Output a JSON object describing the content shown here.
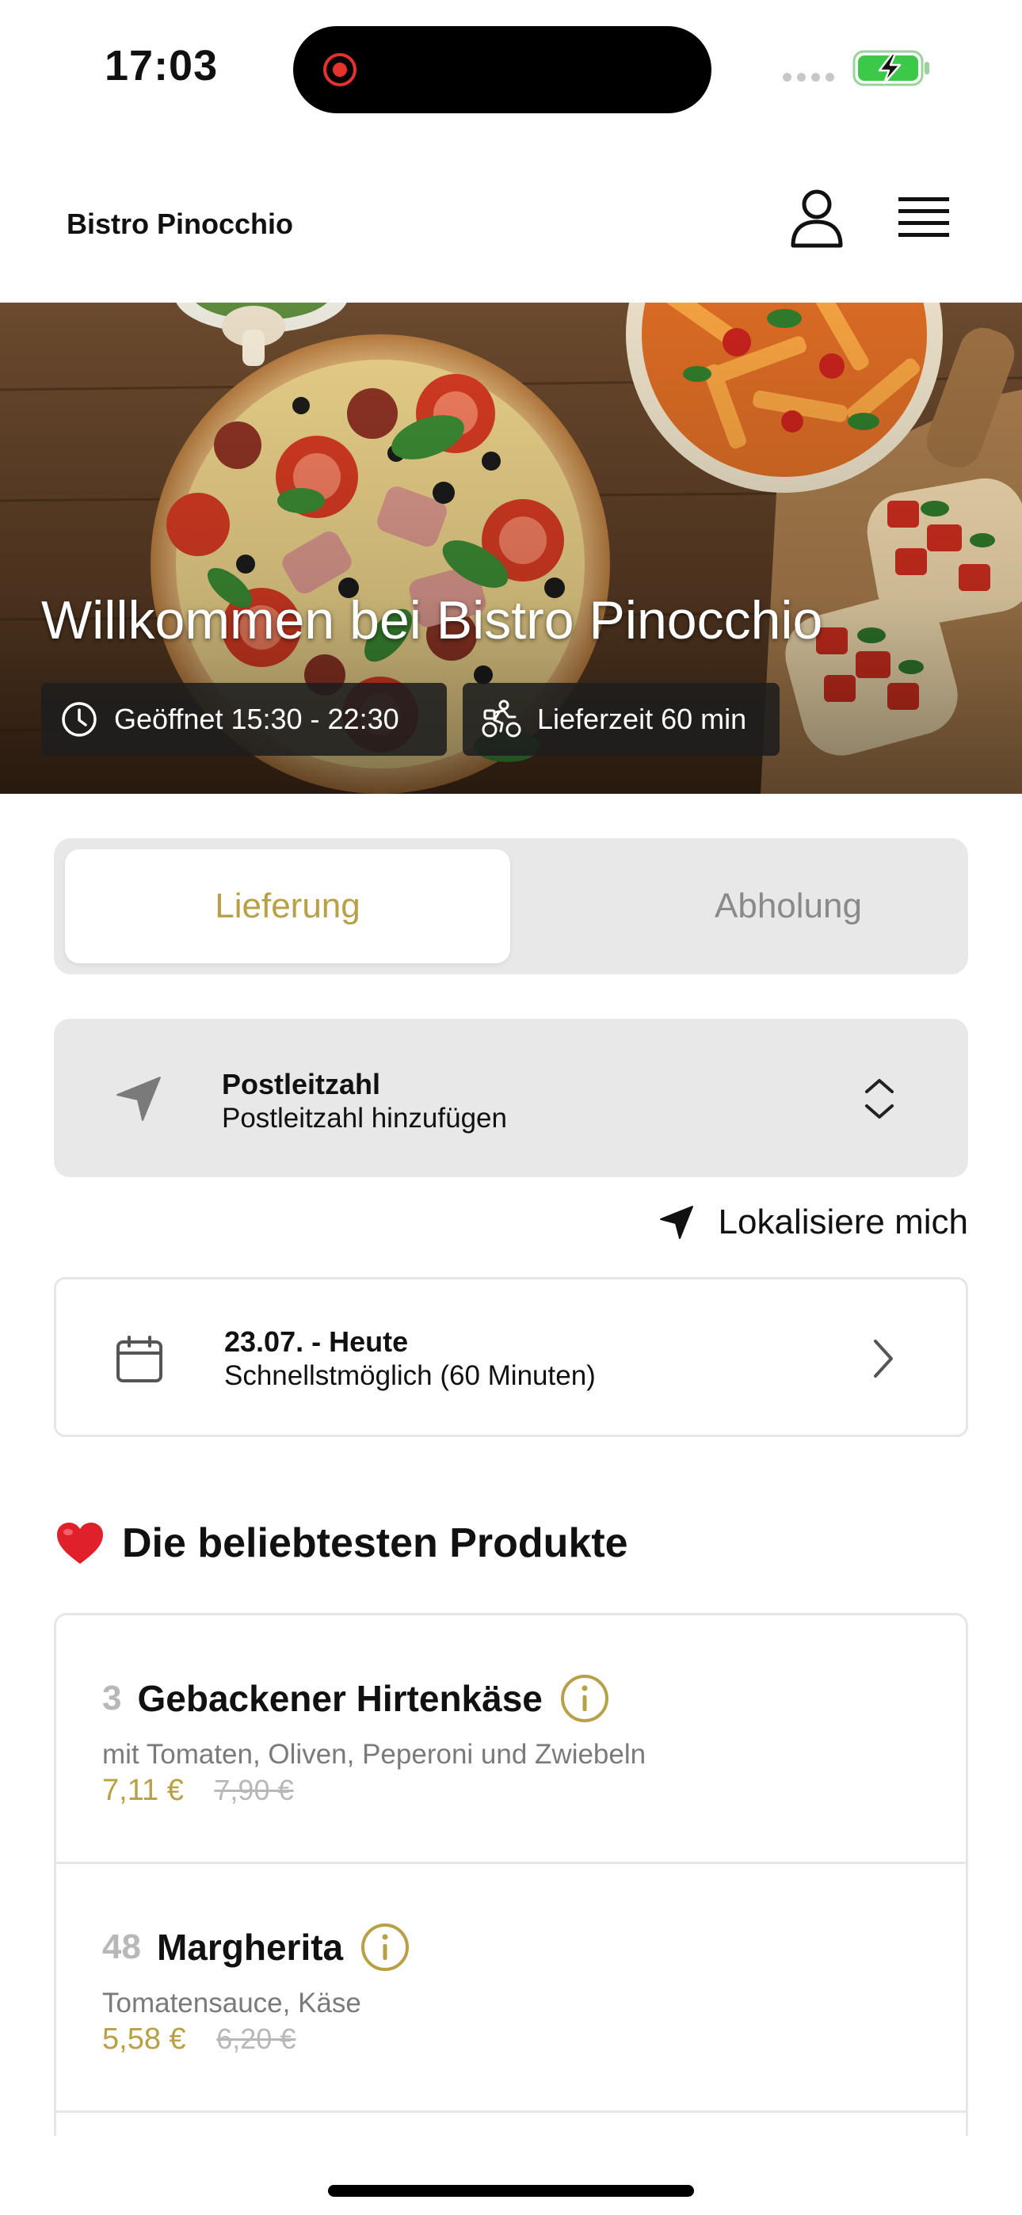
{
  "status_bar": {
    "time": "17:03",
    "battery_icon": "battery-charging-icon",
    "recording_icon": "screen-recording-icon"
  },
  "header": {
    "brand": "Bistro Pinocchio",
    "user_icon": "user-icon",
    "menu_icon": "hamburger-menu-icon"
  },
  "hero": {
    "title": "Willkommen bei Bistro Pinocchio",
    "opening_hours": "Geöffnet 15:30 - 22:30",
    "delivery_time": "Lieferzeit 60 min",
    "opening_icon": "clock-icon",
    "delivery_icon": "bicycle-courier-icon"
  },
  "order_mode": {
    "tabs": [
      {
        "label": "Lieferung",
        "active": true
      },
      {
        "label": "Abholung",
        "active": false
      }
    ]
  },
  "postal_code": {
    "title": "Postleitzahl",
    "placeholder": "Postleitzahl hinzufügen",
    "icon": "location-arrow-icon"
  },
  "locate_me": {
    "label": "Lokalisiere mich",
    "icon": "location-arrow-icon"
  },
  "schedule": {
    "date": "23.07. - Heute",
    "time": "Schnellstmöglich (60 Minuten)",
    "icon": "calendar-icon"
  },
  "popular": {
    "heading": "Die beliebtesten Produkte",
    "icon": "red-heart-icon",
    "products": [
      {
        "number": "3",
        "name": "Gebackener Hirtenkäse",
        "description": "mit Tomaten, Oliven, Peperoni und Zwiebeln",
        "price": "7,11 €",
        "old_price": "7,90 €"
      },
      {
        "number": "48",
        "name": "Margherita",
        "description": "Tomatensauce, Käse",
        "price": "5,58 €",
        "old_price": "6,20 €"
      }
    ]
  },
  "colors": {
    "accent": "#b8a046",
    "panel": "#e8e8e8",
    "muted_text": "#7a7a7a",
    "heart": "#e0202a"
  }
}
